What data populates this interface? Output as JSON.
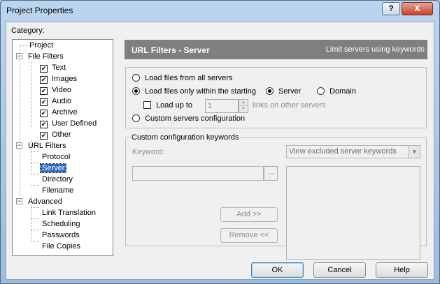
{
  "window": {
    "title": "Project Properties",
    "help_label": "?",
    "close_label": "X"
  },
  "category_label": "Category:",
  "tree": {
    "project": "Project",
    "file_filters": "File Filters",
    "file_filter_items": [
      "Text",
      "Images",
      "Video",
      "Audio",
      "Archive",
      "User Defined",
      "Other"
    ],
    "url_filters": "URL Filters",
    "url_filter_items": [
      "Protocol",
      "Server",
      "Directory",
      "Filename"
    ],
    "advanced": "Advanced",
    "advanced_items": [
      "Link Translation",
      "Scheduling",
      "Passwords",
      "File Copies"
    ],
    "selected": "Server"
  },
  "panel": {
    "title": "URL Filters - Server",
    "subtitle": "Limit servers using keywords"
  },
  "options": {
    "load_all": "Load files from all servers",
    "load_within": "Load files only within the starting",
    "server": "Server",
    "domain": "Domain",
    "load_up_to": "Load up to",
    "load_up_to_value": "1",
    "links_other": "links on other servers",
    "custom": "Custom servers configuration",
    "selected_option": "load_within",
    "selected_scope": "server"
  },
  "custom_group": {
    "legend": "Custom configuration keywords",
    "keyword_label": "Keyword:",
    "keyword_value": "",
    "browse_label": "...",
    "view_select": "View excluded server keywords",
    "add_label": "Add      >>",
    "remove_label": "Remove <<"
  },
  "footer": {
    "ok": "OK",
    "cancel": "Cancel",
    "help": "Help"
  }
}
